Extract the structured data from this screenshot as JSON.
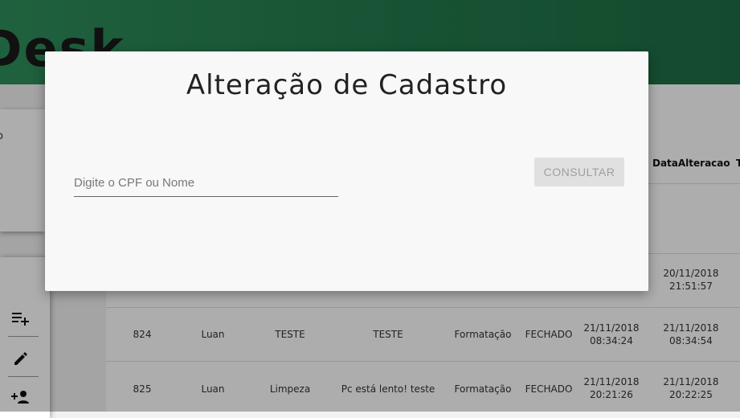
{
  "app": {
    "title_fragment": "Desk"
  },
  "side_card": {
    "text_fragment": "o"
  },
  "toolbar": {
    "buttons": [
      {
        "icon": "playlist-add-icon",
        "glyph": "≡+"
      },
      {
        "icon": "pencil-icon",
        "glyph": "✎"
      },
      {
        "icon": "person-add-icon",
        "glyph": "+👤"
      }
    ]
  },
  "table": {
    "header_alteracao": "DataAlteracao",
    "header_next": "T",
    "row_partial": {
      "data_alteracao": [
        "20/11/2018",
        "21:51:57"
      ]
    },
    "rows": [
      {
        "id": "824",
        "user": "Luan",
        "title": "TESTE",
        "desc": "TESTE",
        "type": "Formatação",
        "status": "FECHADO",
        "date_open": [
          "21/11/2018",
          "08:34:24"
        ],
        "date_alt": [
          "21/11/2018",
          "08:34:54"
        ]
      },
      {
        "id": "825",
        "user": "Luan",
        "title": "Limpeza",
        "desc": "Pc está lento! teste",
        "type": "Formatação",
        "status": "FECHADO",
        "date_open": [
          "21/11/2018",
          "20:21:26"
        ],
        "date_alt": [
          "21/11/2018",
          "20:22:25"
        ]
      }
    ]
  },
  "modal": {
    "title": "Alteração de Cadastro",
    "search_placeholder": "Digite o CPF ou Nome",
    "search_value": "",
    "consult_label": "CONSULTAR"
  },
  "colors": {
    "header_green": "#237a4d",
    "overlay": "rgba(0,0,0,0.32)",
    "button_disabled_bg": "#e0e0e0",
    "button_disabled_text": "#9e9e9e"
  }
}
